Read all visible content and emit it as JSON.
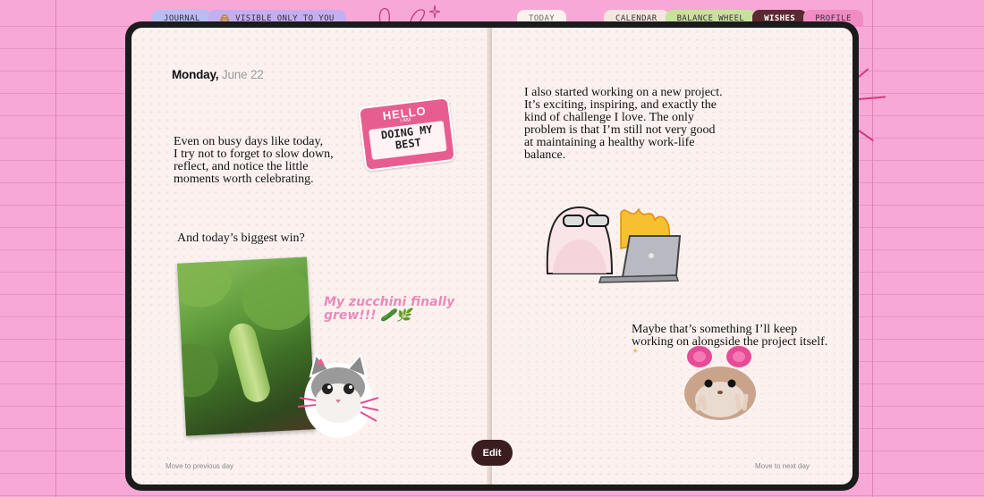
{
  "tabs": {
    "journal": "JOURNAL",
    "visible": "🙈 VISIBLE ONLY TO YOU",
    "today": "TODAY",
    "calendar": "CALENDAR",
    "balance_wheel": "BALANCE WHEEL",
    "wishes": "WISHES",
    "profile": "PROFILE"
  },
  "date": {
    "weekday": "Monday,",
    "month_day": "June 22"
  },
  "left_page": {
    "paragraph1": [
      "Even on busy days like today,",
      "I try not to forget to slow down,",
      "reflect, and notice the little",
      "moments worth celebrating."
    ],
    "paragraph2": "And today’s biggest win?",
    "caption": [
      "My zucchini finally",
      "grew!!! 🥒🌿"
    ],
    "prev_link": "Move to previous day"
  },
  "right_page": {
    "paragraph1": [
      "I also started working on a new project.",
      "It’s exciting, inspiring, and exactly the",
      "kind of challenge I love. The only",
      "problem is that I’m still not very good",
      "at maintaining a healthy work-life",
      "balance."
    ],
    "paragraph2": [
      "Maybe that’s something I’ll keep",
      "working on alongside the project itself."
    ],
    "next_link": "Move to next day"
  },
  "sticker": {
    "hello": "HELLO",
    "iam": "I AM",
    "line1": "DOING MY",
    "line2": "BEST"
  },
  "edit_button": "Edit",
  "colors": {
    "background": "#f7a8d6",
    "page": "#fbf2f0",
    "book_frame": "#1b1b1b",
    "edit_button": "#3b1d1f",
    "accent_pink": "#e98ab8"
  },
  "icons": [
    "bunny-ears-doodle-icon",
    "sparkle-doodle-icon",
    "sparkle-icon"
  ]
}
